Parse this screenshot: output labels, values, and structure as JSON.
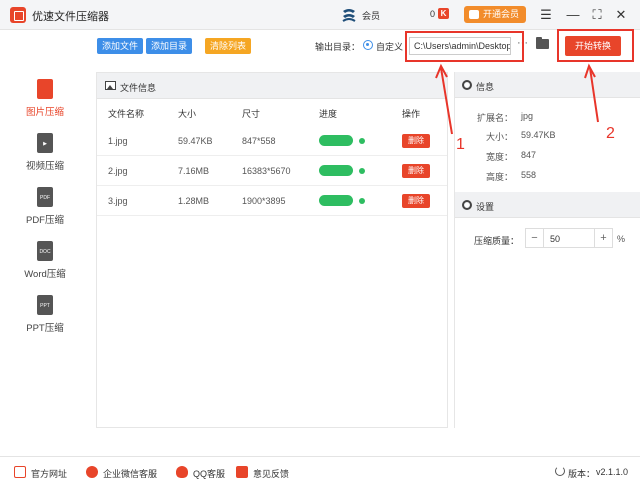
{
  "titlebar": {
    "app_title": "优速文件压缩器",
    "user_name": "会员",
    "coin_count": "0",
    "coin_icon": "K",
    "vip_label": "开通会员",
    "menu_glyph": "☰",
    "minimize_glyph": "—",
    "maximize_glyph": "⛶",
    "close_glyph": "✕"
  },
  "sidebar": {
    "items": [
      {
        "label": "图片压缩",
        "icon": "image-icon",
        "icon_text": "",
        "active": true
      },
      {
        "label": "视频压缩",
        "icon": "video-icon",
        "icon_text": "▶",
        "active": false
      },
      {
        "label": "PDF压缩",
        "icon": "pdf-icon",
        "icon_text": "PDF",
        "active": false
      },
      {
        "label": "Word压缩",
        "icon": "doc-icon",
        "icon_text": "DOC",
        "active": false
      },
      {
        "label": "PPT压缩",
        "icon": "ppt-icon",
        "icon_text": "PPT",
        "active": false
      }
    ]
  },
  "toolbar": {
    "add_file": "添加文件",
    "add_dir": "添加目录",
    "clear_list": "清除列表",
    "output_label": "输出目录：",
    "custom_label": "自定义",
    "path_value": "C:\\Users\\admin\\Desktop",
    "dots": "···",
    "start_label": "开始转换"
  },
  "file_panel": {
    "title": "文件信息",
    "columns": [
      "文件名称",
      "大小",
      "尺寸",
      "进度",
      "操作"
    ],
    "delete_label": "删除",
    "rows": [
      {
        "name": "1.jpg",
        "size": "59.47KB",
        "dims": "847*558",
        "progress": 1.0
      },
      {
        "name": "2.jpg",
        "size": "7.16MB",
        "dims": "16383*5670",
        "progress": 1.0
      },
      {
        "name": "3.jpg",
        "size": "1.28MB",
        "dims": "1900*3895",
        "progress": 1.0
      }
    ]
  },
  "info_panel": {
    "title": "信息",
    "ext_key": "扩展名：",
    "ext_val": "jpg",
    "size_key": "大小：",
    "size_val": "59.47KB",
    "width_key": "宽度：",
    "width_val": "847",
    "height_key": "高度：",
    "height_val": "558"
  },
  "settings_panel": {
    "title": "设置",
    "quality_label": "压缩质量：",
    "quality_value": "50",
    "minus": "−",
    "plus": "+",
    "unit": "%"
  },
  "bottombar": {
    "website": "官方网址",
    "wechat": "企业微信客服",
    "qq": "QQ客服",
    "feedback": "意见反馈",
    "version_label": "版本：",
    "version_value": "v2.1.1.0"
  },
  "annotations": {
    "label_1": "1",
    "label_2": "2",
    "color": "#e8352a"
  },
  "colors": {
    "accent": "#e8452a",
    "blue": "#3d8ee8",
    "orange": "#f5a623",
    "progress": "#2ebd61"
  }
}
